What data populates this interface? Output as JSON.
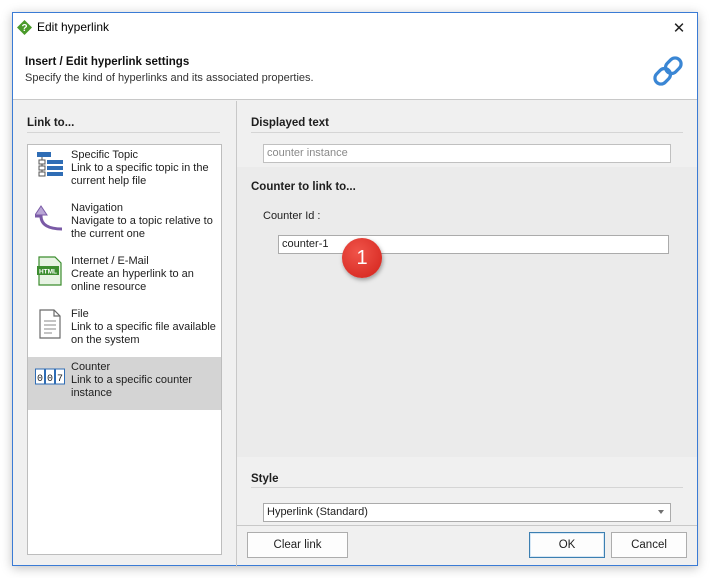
{
  "window": {
    "title": "Edit hyperlink",
    "close_glyph": "✕"
  },
  "header": {
    "title": "Insert / Edit hyperlink settings",
    "subtitle": "Specify the kind of hyperlinks and its associated properties."
  },
  "link_to": {
    "label": "Link to...",
    "items": [
      {
        "title": "Specific Topic",
        "desc": "Link to a specific topic in the current help file",
        "icon": "topic-tree-icon"
      },
      {
        "title": "Navigation",
        "desc": "Navigate to a topic relative to the current one",
        "icon": "navigation-arrow-icon"
      },
      {
        "title": "Internet / E-Mail",
        "desc": "Create an hyperlink to an online resource",
        "icon": "html-file-icon"
      },
      {
        "title": "File",
        "desc": "Link to a specific file available on the system",
        "icon": "file-icon"
      },
      {
        "title": "Counter",
        "desc": "Link to a specific counter instance",
        "icon": "counter-icon"
      }
    ],
    "selected": "Counter"
  },
  "displayed_text": {
    "label": "Displayed text",
    "value": "counter instance"
  },
  "counter": {
    "label": "Counter to link to...",
    "id_label": "Counter Id :",
    "id_value": "counter-1",
    "badge": "1"
  },
  "style": {
    "label": "Style",
    "value": "Hyperlink (Standard)"
  },
  "buttons": {
    "clear": "Clear link",
    "ok": "OK",
    "cancel": "Cancel"
  },
  "colors": {
    "accent": "#3a7bd5",
    "badge": "#d9261c",
    "selected_item": "#d4d4d4",
    "icon_blue": "#2f6db5",
    "icon_green": "#3c8d2f"
  }
}
